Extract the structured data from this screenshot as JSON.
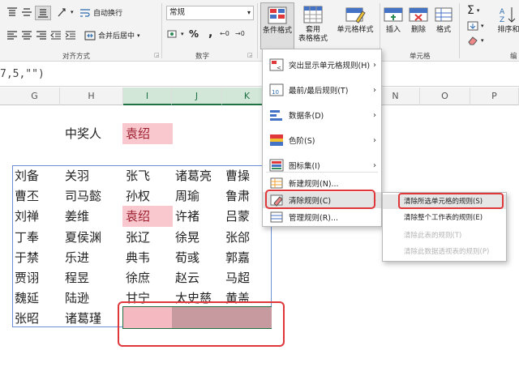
{
  "ribbon": {
    "alignment_group": "对齐方式",
    "number_group": "数字",
    "cells_group": "单元格",
    "editing_group": "编",
    "wrap_text": "自动换行",
    "merge_center": "合并后居中",
    "number_format": "常规",
    "cond_format": "条件格式",
    "table_format": "套用\n表格格式",
    "cell_styles": "单元格样式",
    "insert": "插入",
    "delete": "删除",
    "format": "格式",
    "sort_filter": "排序和"
  },
  "formula_bar": {
    "text": "7,5,\"\")"
  },
  "columns": [
    "G",
    "H",
    "I",
    "J",
    "K",
    "N",
    "O",
    "P"
  ],
  "winner": {
    "label": "中奖人",
    "value": "袁绍"
  },
  "names": [
    [
      "刘备",
      "关羽",
      "张飞",
      "诸葛亮",
      "曹操"
    ],
    [
      "曹丕",
      "司马懿",
      "孙权",
      "周瑜",
      "鲁肃"
    ],
    [
      "刘禅",
      "姜维",
      "袁绍",
      "许褚",
      "吕蒙"
    ],
    [
      "丁奉",
      "夏侯渊",
      "张辽",
      "徐晃",
      "张郃"
    ],
    [
      "于禁",
      "乐进",
      "典韦",
      "荀彧",
      "郭嘉"
    ],
    [
      "贾诩",
      "程昱",
      "徐庶",
      "赵云",
      "马超"
    ],
    [
      "魏延",
      "陆逊",
      "甘宁",
      "太史慈",
      "黄盖"
    ],
    [
      "张昭",
      "诸葛瑾",
      "",
      "",
      ""
    ]
  ],
  "cf_menu": {
    "items": [
      {
        "label": "突出显示单元格规则(H)",
        "icon": "highlight-rules-icon"
      },
      {
        "label": "最前/最后规则(T)",
        "icon": "top-bottom-icon"
      },
      {
        "label": "数据条(D)",
        "icon": "data-bars-icon"
      },
      {
        "label": "色阶(S)",
        "icon": "color-scales-icon"
      },
      {
        "label": "图标集(I)",
        "icon": "icon-sets-icon"
      }
    ],
    "new_rule": "新建规则(N)...",
    "clear_rules": "清除规则(C)",
    "manage_rules": "管理规则(R)..."
  },
  "clear_submenu": [
    {
      "label": "清除所选单元格的规则(S)",
      "enabled": true
    },
    {
      "label": "清除整个工作表的规则(E)",
      "enabled": true
    },
    {
      "label": "清除此表的规则(T)",
      "enabled": false
    },
    {
      "label": "清除此数据透视表的规则(P)",
      "enabled": false
    }
  ],
  "colors": {
    "highlight_pink": "#f9c8cf",
    "highlight_text": "#9c1c2b",
    "annotation_red": "#e0373b",
    "excel_green": "#217346"
  }
}
